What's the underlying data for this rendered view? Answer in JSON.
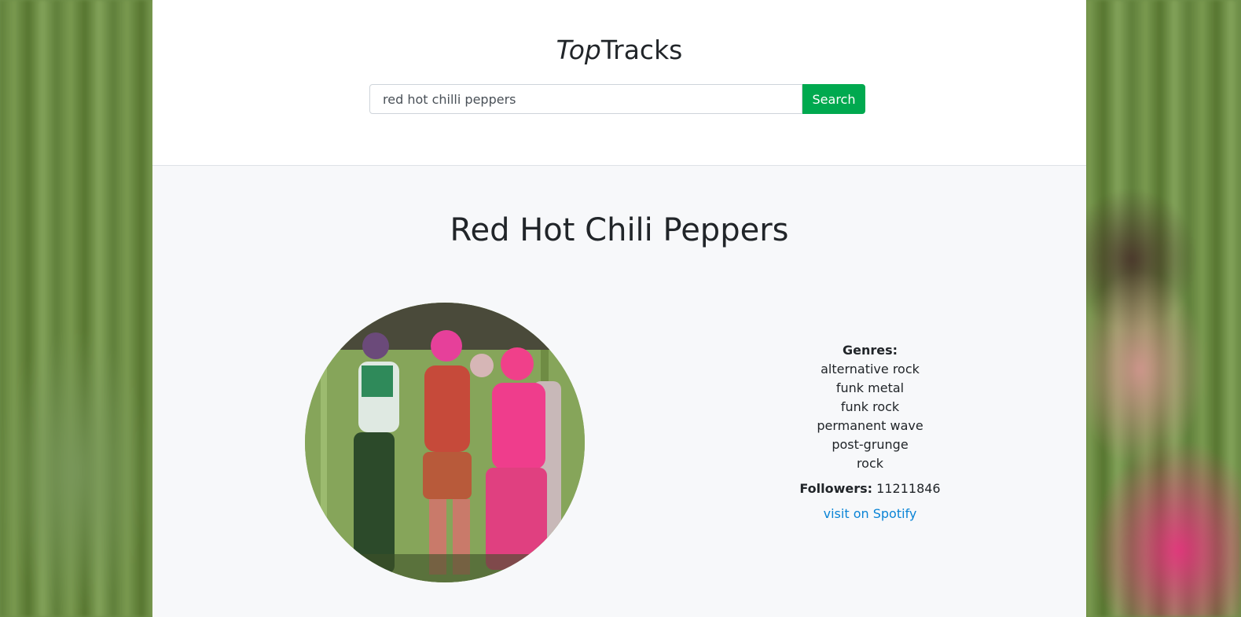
{
  "brand": {
    "italic_part": "Top",
    "regular_part": "Tracks"
  },
  "search": {
    "value": "red hot chilli peppers",
    "button_label": "Search"
  },
  "artist": {
    "name": "Red Hot Chili Peppers",
    "genres_label": "Genres:",
    "genres": [
      "alternative rock",
      "funk metal",
      "funk rock",
      "permanent wave",
      "post-grunge",
      "rock"
    ],
    "followers_label": "Followers:",
    "followers_value": "11211846",
    "spotify_link_label": "visit on Spotify"
  },
  "colors": {
    "search_button": "#00a94f",
    "link": "#0a84d6",
    "content_background": "#f7f8fa"
  }
}
